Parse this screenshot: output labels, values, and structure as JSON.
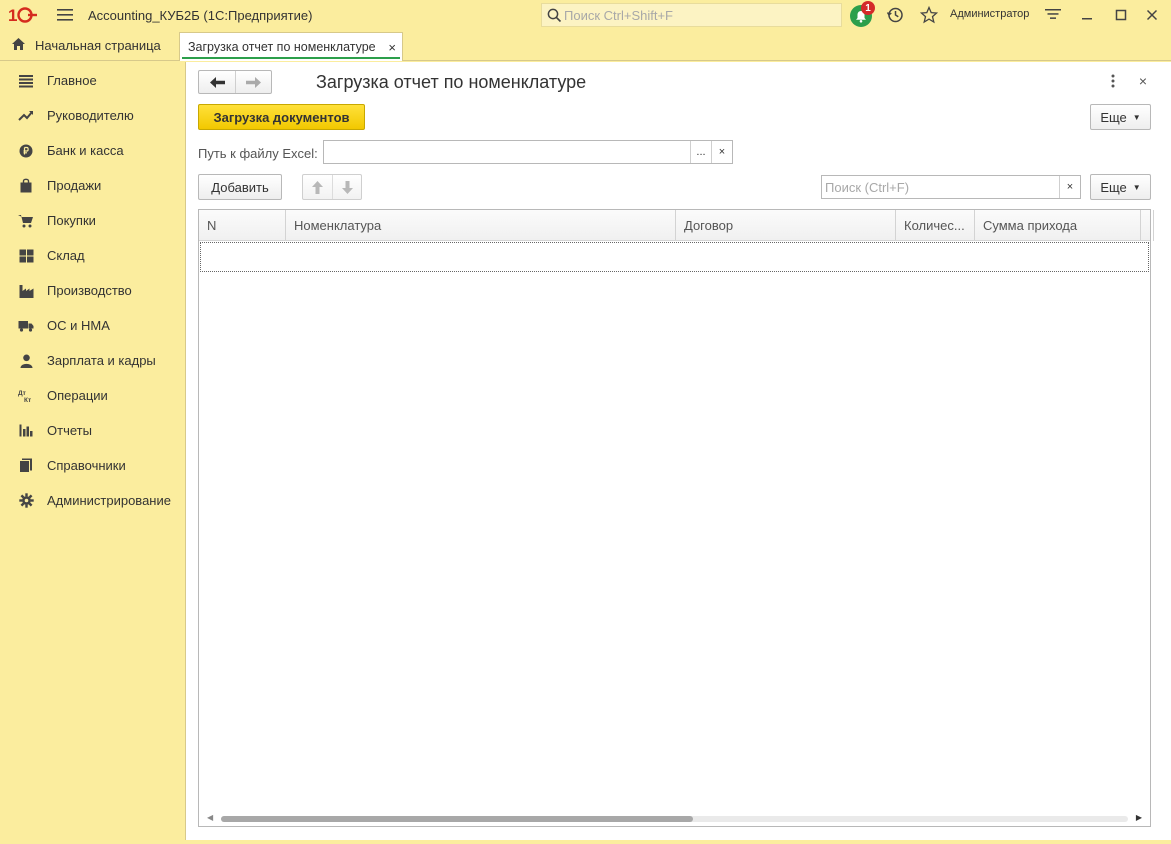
{
  "titlebar": {
    "app_title": "Accounting_КУБ2Б  (1С:Предприятие)",
    "search_placeholder": "Поиск Ctrl+Shift+F",
    "notification_count": "1",
    "user_name": "Администратор"
  },
  "tabs": {
    "home_label": "Начальная страница",
    "active_label": "Загрузка отчет по номенклатуре",
    "active_close": "×"
  },
  "sidebar": {
    "items": [
      {
        "label": "Главное",
        "icon": "menu-lines-icon"
      },
      {
        "label": "Руководителю",
        "icon": "trend-icon"
      },
      {
        "label": "Банк и касса",
        "icon": "ruble-coin-icon"
      },
      {
        "label": "Продажи",
        "icon": "shopping-bag-icon"
      },
      {
        "label": "Покупки",
        "icon": "cart-icon"
      },
      {
        "label": "Склад",
        "icon": "warehouse-icon"
      },
      {
        "label": "Производство",
        "icon": "factory-icon"
      },
      {
        "label": "ОС и НМА",
        "icon": "truck-icon"
      },
      {
        "label": "Зарплата и кадры",
        "icon": "person-icon"
      },
      {
        "label": "Операции",
        "icon": "dt-kt-icon"
      },
      {
        "label": "Отчеты",
        "icon": "bar-chart-icon"
      },
      {
        "label": "Справочники",
        "icon": "books-icon"
      },
      {
        "label": "Администрирование",
        "icon": "gear-icon"
      }
    ],
    "dt": "Дт",
    "kt": "Кт"
  },
  "form": {
    "title": "Загрузка отчет по номенклатуре",
    "load_button": "Загрузка документов",
    "more_label": "Еще",
    "path_label": "Путь к файлу Excel:",
    "path_value": "",
    "select_button": "...",
    "clear_button": "×",
    "add_button": "Добавить",
    "search_placeholder": "Поиск (Ctrl+F)",
    "search_clear": "×",
    "close_label": "×"
  },
  "table": {
    "columns": [
      "N",
      "Номенклатура",
      "Договор",
      "Количес...",
      "Сумма прихода"
    ],
    "rows": [],
    "scroll_position": 0.52
  }
}
